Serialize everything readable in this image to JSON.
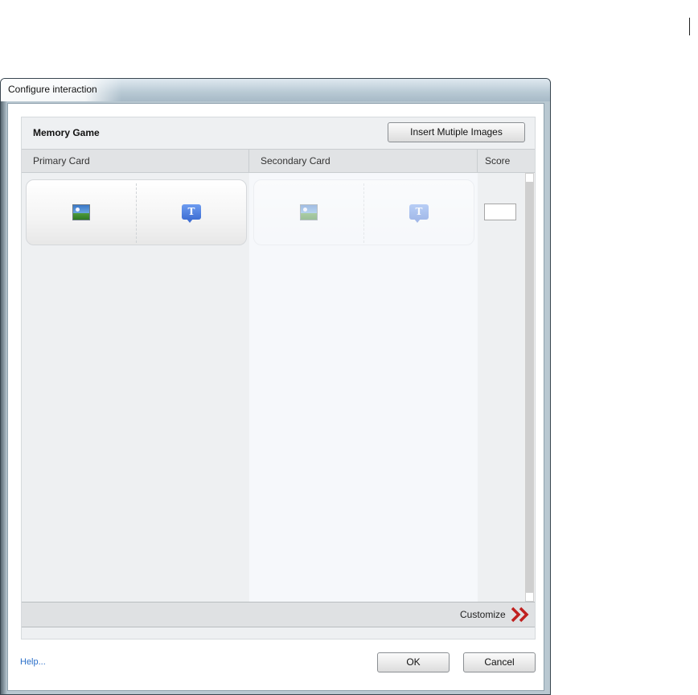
{
  "window": {
    "title": "Configure interaction"
  },
  "interaction": {
    "title": "Memory Game",
    "insert_button": "Insert Mutiple Images"
  },
  "columns": {
    "primary": "Primary Card",
    "secondary": "Secondary Card",
    "score": "Score"
  },
  "rows": [
    {
      "primary": {
        "left_icon": "image-icon",
        "right_icon": "text-icon"
      },
      "secondary": {
        "left_icon": "image-icon",
        "right_icon": "text-icon",
        "state": "disabled"
      },
      "score": "",
      "text_icon_glyph": "T"
    }
  ],
  "footer": {
    "customize": "Customize",
    "customize_icon": "double-chevron-right-icon"
  },
  "help_link": "Help...",
  "buttons": {
    "ok": "OK",
    "cancel": "Cancel"
  },
  "colors": {
    "link": "#2a6fc9",
    "accent_chevron": "#c0201f",
    "text_icon": "#4a7be0"
  }
}
